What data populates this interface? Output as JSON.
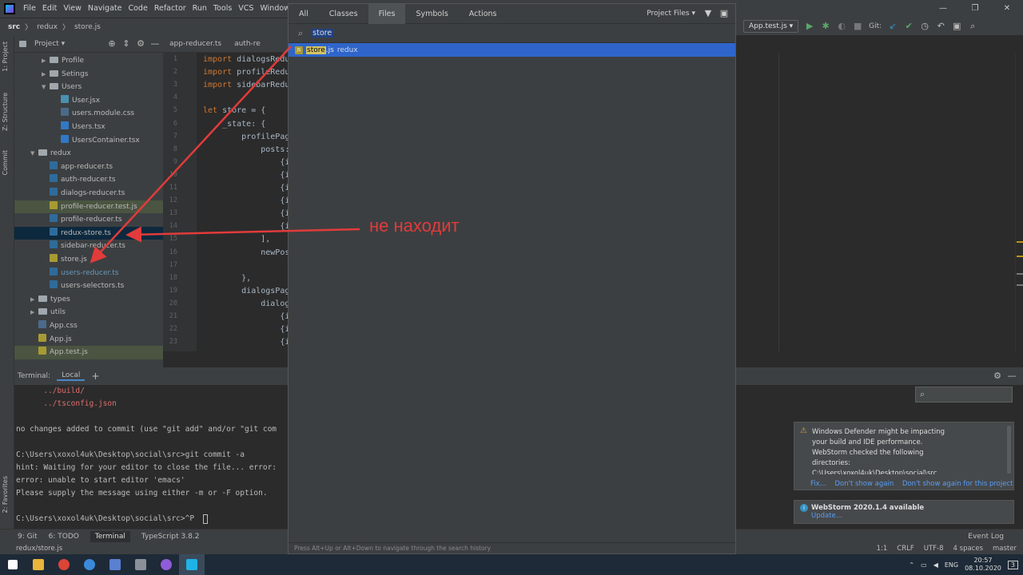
{
  "menubar": {
    "items": [
      "File",
      "Edit",
      "View",
      "Navigate",
      "Code",
      "Refactor",
      "Run",
      "Tools",
      "VCS",
      "Window",
      "He"
    ]
  },
  "navbar": {
    "crumbs": [
      "src",
      "redux",
      "store.js"
    ]
  },
  "toolbar": {
    "run_config": "App.test.js ▾",
    "git_label": "Git:"
  },
  "left_strip": {
    "project": "1: Project",
    "structure": "Z: Structure",
    "commit": "Commit",
    "favorites": "2: Favorites"
  },
  "project_panel": {
    "title": "Project ▾",
    "rows": [
      {
        "label": "Profile",
        "kind": "folder",
        "depth": 2
      },
      {
        "label": "Setings",
        "kind": "folder",
        "depth": 2
      },
      {
        "label": "Users",
        "kind": "folder-open",
        "depth": 2
      },
      {
        "label": "User.jsx",
        "kind": "jsx",
        "depth": 3
      },
      {
        "label": "users.module.css",
        "kind": "css",
        "depth": 3
      },
      {
        "label": "Users.tsx",
        "kind": "tsx",
        "depth": 3
      },
      {
        "label": "UsersContainer.tsx",
        "kind": "tsx",
        "depth": 3
      },
      {
        "label": "redux",
        "kind": "folder-open",
        "depth": 1
      },
      {
        "label": "app-reducer.ts",
        "kind": "ts",
        "depth": 2
      },
      {
        "label": "auth-reducer.ts",
        "kind": "ts",
        "depth": 2
      },
      {
        "label": "dialogs-reducer.ts",
        "kind": "ts",
        "depth": 2
      },
      {
        "label": "profile-reducer.test.js",
        "kind": "js",
        "depth": 2
      },
      {
        "label": "profile-reducer.ts",
        "kind": "ts",
        "depth": 2
      },
      {
        "label": "redux-store.ts",
        "kind": "ts",
        "depth": 2
      },
      {
        "label": "sidebar-reducer.ts",
        "kind": "ts",
        "depth": 2
      },
      {
        "label": "store.js",
        "kind": "js",
        "depth": 2
      },
      {
        "label": "users-reducer.ts",
        "kind": "ts",
        "depth": 2
      },
      {
        "label": "users-selectors.ts",
        "kind": "ts",
        "depth": 2
      },
      {
        "label": "types",
        "kind": "folder",
        "depth": 1
      },
      {
        "label": "utils",
        "kind": "folder",
        "depth": 1
      },
      {
        "label": "App.css",
        "kind": "css",
        "depth": 1
      },
      {
        "label": "App.js",
        "kind": "js",
        "depth": 1
      },
      {
        "label": "App.test.js",
        "kind": "js",
        "depth": 1
      }
    ]
  },
  "editor": {
    "tabs": [
      "app-reducer.ts",
      "auth-re"
    ],
    "line_numbers": [
      "1",
      "2",
      "3",
      "4",
      "5",
      "6",
      "7",
      "8",
      "9",
      "10",
      "11",
      "12",
      "13",
      "14",
      "15",
      "16",
      "17",
      "18",
      "19",
      "20",
      "21",
      "22",
      "23"
    ],
    "lines": [
      {
        "kw": "import",
        "rest": " dialogsRedu"
      },
      {
        "kw": "import",
        "rest": " profileRedu"
      },
      {
        "kw": "import",
        "rest": " sidebarRedu"
      },
      {
        "kw": "",
        "rest": ""
      },
      {
        "kw": "let",
        "rest": " store = {"
      },
      {
        "kw": "",
        "rest": "    _state: {"
      },
      {
        "kw": "",
        "rest": "        profilePag"
      },
      {
        "kw": "",
        "rest": "            posts:"
      },
      {
        "kw": "",
        "rest": "                {i"
      },
      {
        "kw": "",
        "rest": "                {i"
      },
      {
        "kw": "",
        "rest": "                {i"
      },
      {
        "kw": "",
        "rest": "                {i"
      },
      {
        "kw": "",
        "rest": "                {i"
      },
      {
        "kw": "",
        "rest": "                {i"
      },
      {
        "kw": "",
        "rest": "            ],"
      },
      {
        "kw": "",
        "rest": "            newPos"
      },
      {
        "kw": "",
        "rest": ""
      },
      {
        "kw": "",
        "rest": "        },"
      },
      {
        "kw": "",
        "rest": "        dialogsPag"
      },
      {
        "kw": "",
        "rest": "            dialog"
      },
      {
        "kw": "",
        "rest": "                {i"
      },
      {
        "kw": "",
        "rest": "                {i"
      },
      {
        "kw": "",
        "rest": "                {i"
      }
    ]
  },
  "terminal": {
    "title": "Terminal:",
    "tab": "Local",
    "add": "+",
    "lines": [
      {
        "text": "      ../build/",
        "color": "red"
      },
      {
        "text": "      ../tsconfig.json",
        "color": "red"
      },
      {
        "text": "",
        "color": "normal"
      },
      {
        "text": "no changes added to commit (use \"git add\" and/or \"git com",
        "color": "normal"
      },
      {
        "text": "",
        "color": "normal"
      },
      {
        "text": "C:\\Users\\xoxol4uk\\Desktop\\social\\src>git commit -a",
        "color": "normal"
      },
      {
        "text": "hint: Waiting for your editor to close the file... error:",
        "color": "normal"
      },
      {
        "text": "error: unable to start editor 'emacs'",
        "color": "normal"
      },
      {
        "text": "Please supply the message using either -m or -F option.",
        "color": "normal"
      },
      {
        "text": "",
        "color": "normal"
      },
      {
        "text": "C:\\Users\\xoxol4uk\\Desktop\\social\\src>^P",
        "color": "normal"
      }
    ]
  },
  "search_popup": {
    "tabs": [
      "All",
      "Classes",
      "Files",
      "Symbols",
      "Actions"
    ],
    "selected_tab": "Files",
    "scope": "Project Files ▾",
    "query": "store",
    "result": {
      "match": "store",
      "rest": ".js",
      "path": "redux"
    },
    "footer": "Press Alt+Up or Alt+Down to navigate through the search history"
  },
  "annotation": {
    "text": "не находит",
    "color": "#e23b3b"
  },
  "notifications": {
    "defender": {
      "lines": [
        "Windows Defender might be impacting",
        "your build and IDE performance.",
        "WebStorm checked the following",
        "directories:",
        "C:\\Users\\xoxol4uk\\Desktop\\social\\src"
      ],
      "actions": [
        "Fix...",
        "Don't show again",
        "Don't show again for this project"
      ]
    },
    "update": {
      "title": "WebStorm 2020.1.4 available",
      "action": "Update..."
    }
  },
  "statusbar": {
    "items": [
      "9: Git",
      "6: TODO",
      "Terminal",
      "TypeScript 3.8.2"
    ],
    "event_log": "Event Log"
  },
  "pathbar": {
    "path": "redux/store.js",
    "right": [
      "1:1",
      "CRLF",
      "UTF-8",
      "4 spaces",
      "master"
    ]
  },
  "taskbar": {
    "lang": "ENG",
    "time": "20:57",
    "date": "08.10.2020",
    "notif_count": "3"
  }
}
